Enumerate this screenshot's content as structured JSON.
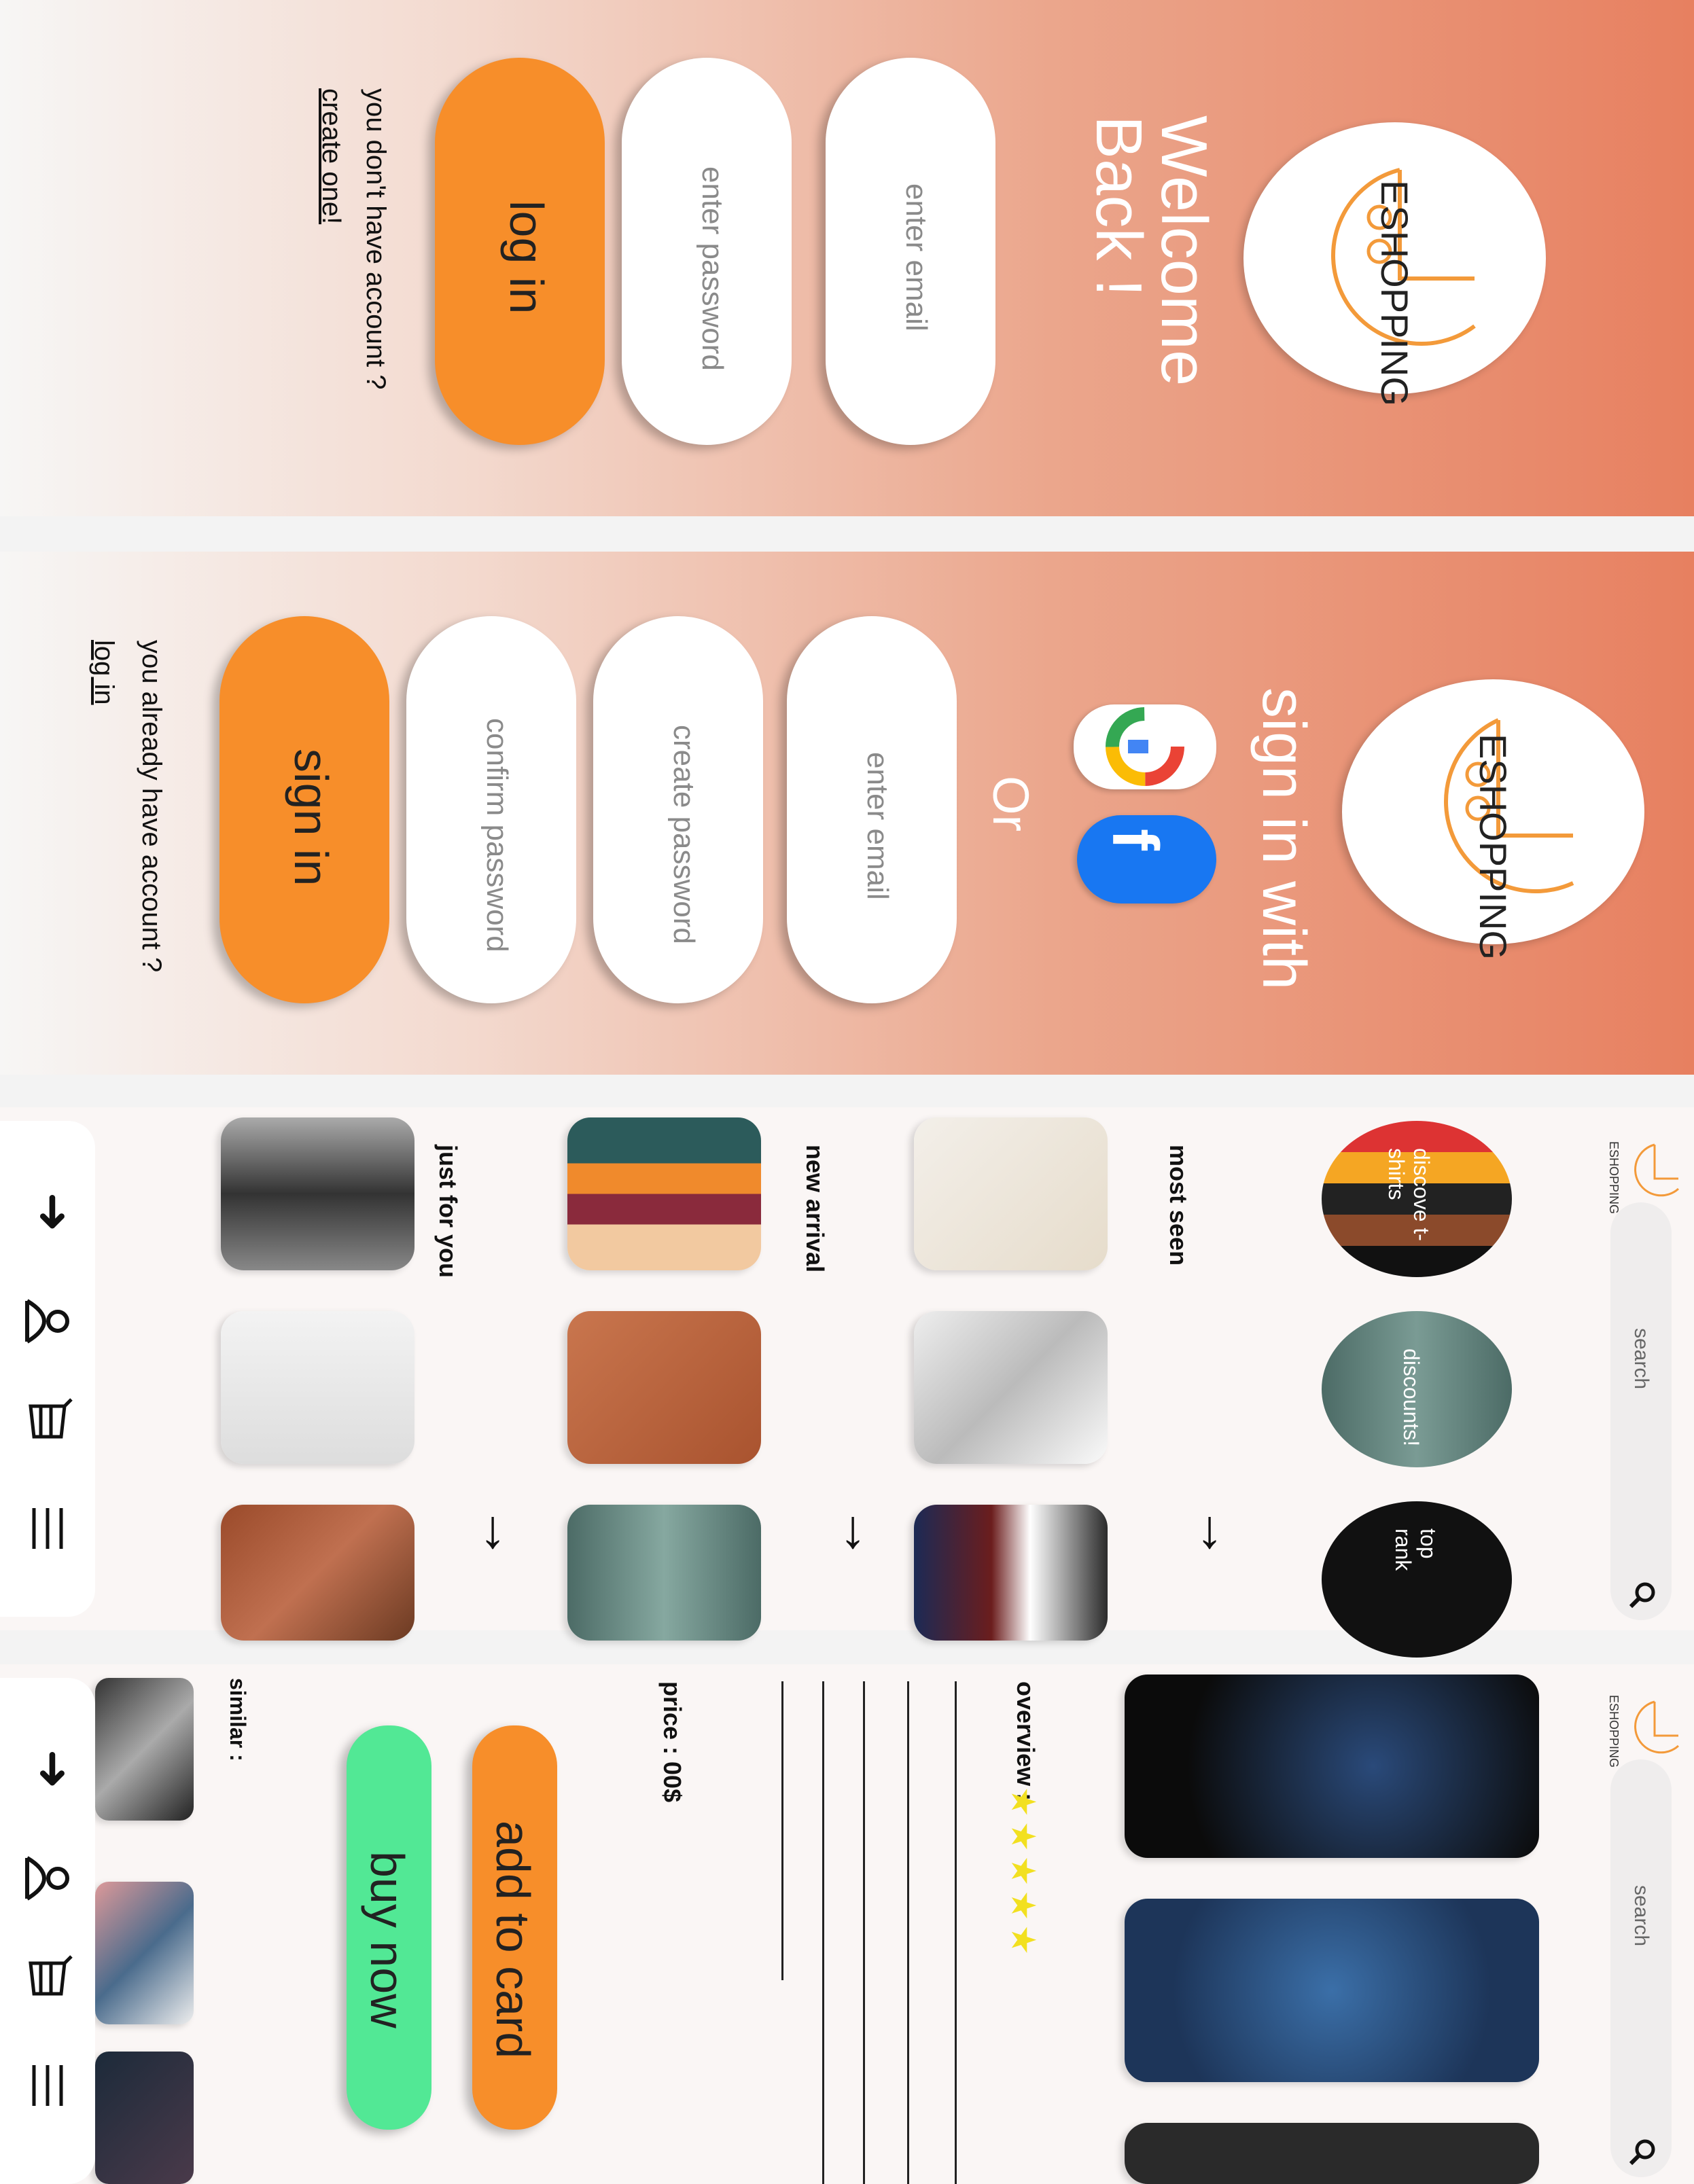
{
  "brand": {
    "name": "ESHOPPING",
    "accent": "#f78e2a",
    "green": "#52e895"
  },
  "login": {
    "title": "Welcome Back !",
    "email_placeholder": "enter email",
    "password_placeholder": "enter password",
    "login_button": "log in",
    "no_account_text": "you don't have account ?",
    "create_link": "create one!"
  },
  "signup": {
    "title": "sign in with",
    "or_text": "Or",
    "google_icon": "google-icon",
    "facebook_icon": "facebook-icon",
    "email_placeholder": "enter email",
    "create_password_placeholder": "create password",
    "confirm_password_placeholder": "confirm password",
    "signin_button": "sign in",
    "have_account_text": "you already have account ?",
    "login_link": "log in"
  },
  "home": {
    "search_placeholder": "search",
    "categories": [
      "discove t-shirts",
      "discounts!",
      "top rank"
    ],
    "sections": [
      "most seen",
      "new arrival",
      "just for you"
    ],
    "more_arrow": "↓",
    "nav_icons": [
      "shoes-icon",
      "profile-icon",
      "cart-icon",
      "menu-icon"
    ]
  },
  "product": {
    "search_placeholder": "search",
    "overview_label": "overview :",
    "rating_stars": 5,
    "stars": "★★★★★",
    "price": "price : 00$",
    "add_to_cart": "add to card",
    "buy_now": "buy now",
    "similar_label": "similar :"
  }
}
